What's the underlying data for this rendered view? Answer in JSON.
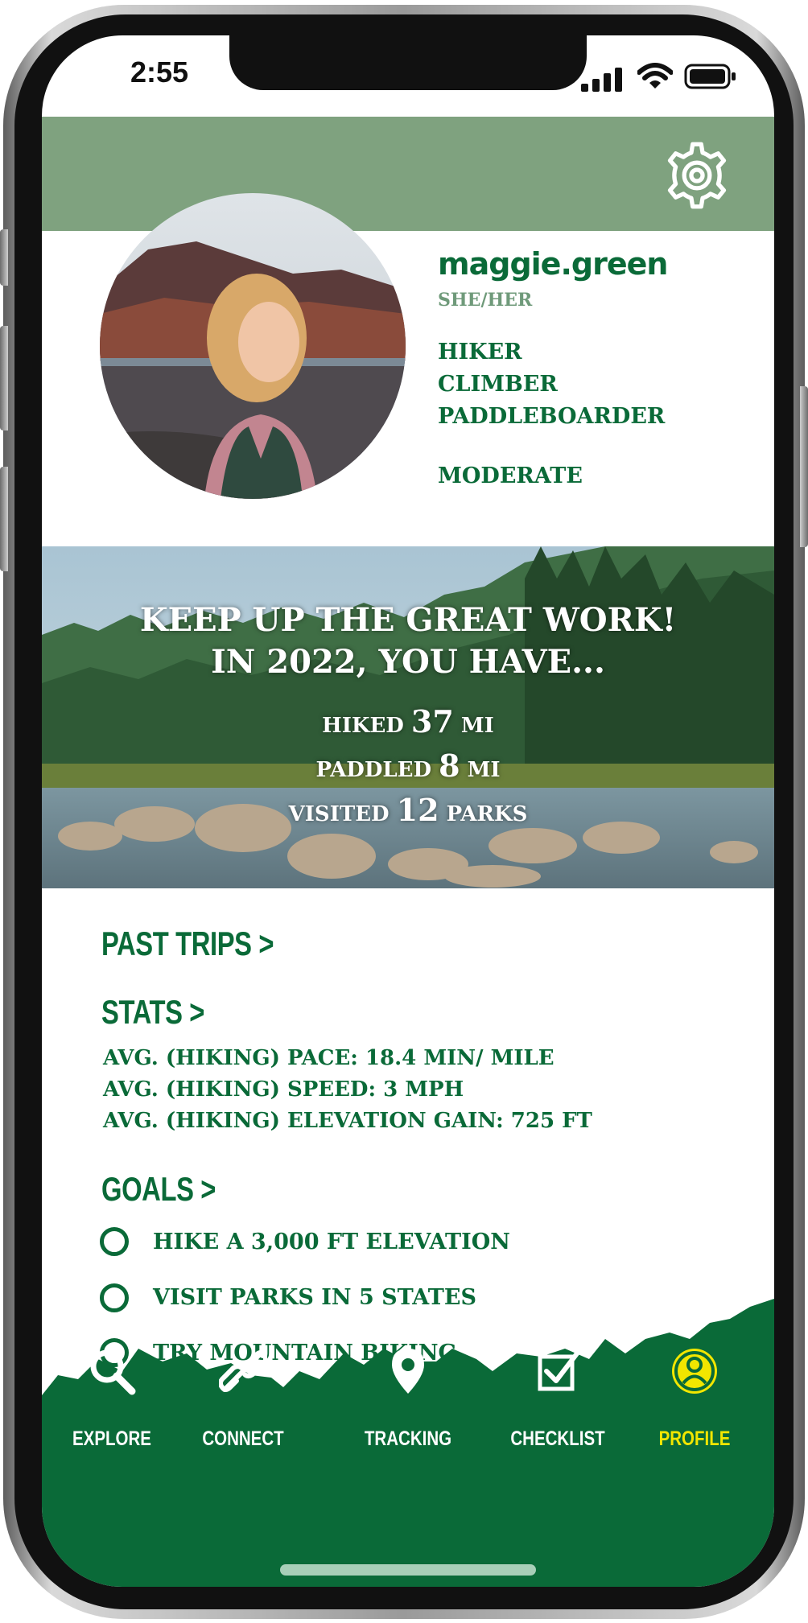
{
  "status_bar": {
    "time": "2:55"
  },
  "profile": {
    "username": "maggie.green",
    "pronouns": "SHE/HER",
    "roles": [
      "HIKER",
      "CLIMBER",
      "PADDLEBOARDER"
    ],
    "level": "MODERATE"
  },
  "banner": {
    "title_line1": "KEEP UP THE GREAT WORK!",
    "title_line2": "IN 2022, YOU HAVE...",
    "stats": [
      {
        "label": "HIKED",
        "value": "37",
        "unit": "MI"
      },
      {
        "label": "PADDLED",
        "value": "8",
        "unit": "MI"
      },
      {
        "label": "VISITED",
        "value": "12",
        "unit": "PARKS"
      }
    ]
  },
  "sections": {
    "past_trips": "PAST TRIPS >",
    "stats": "STATS >",
    "goals": "GOALS >"
  },
  "stats_rows": [
    "AVG. (HIKING) PACE: 18.4 MIN/ MILE",
    "AVG. (HIKING) SPEED: 3 MPH",
    "AVG. (HIKING) ELEVATION GAIN: 725 FT"
  ],
  "goals": [
    "HIKE  A 3,000 FT ELEVATION",
    "VISIT PARKS IN 5 STATES",
    "TRY MOUNTAIN BIKING"
  ],
  "nav": {
    "items": [
      {
        "label": "EXPLORE",
        "icon": "search-icon"
      },
      {
        "label": "CONNECT",
        "icon": "link-icon"
      },
      {
        "label": "TRACKING",
        "icon": "map-pin-icon"
      },
      {
        "label": "CHECKLIST",
        "icon": "checkbox-icon"
      },
      {
        "label": "PROFILE",
        "icon": "user-circle-icon",
        "active": true
      }
    ]
  },
  "colors": {
    "brand_green": "#0a6a38",
    "header_green": "#7fa27f",
    "active_nav": "#f2e600"
  }
}
